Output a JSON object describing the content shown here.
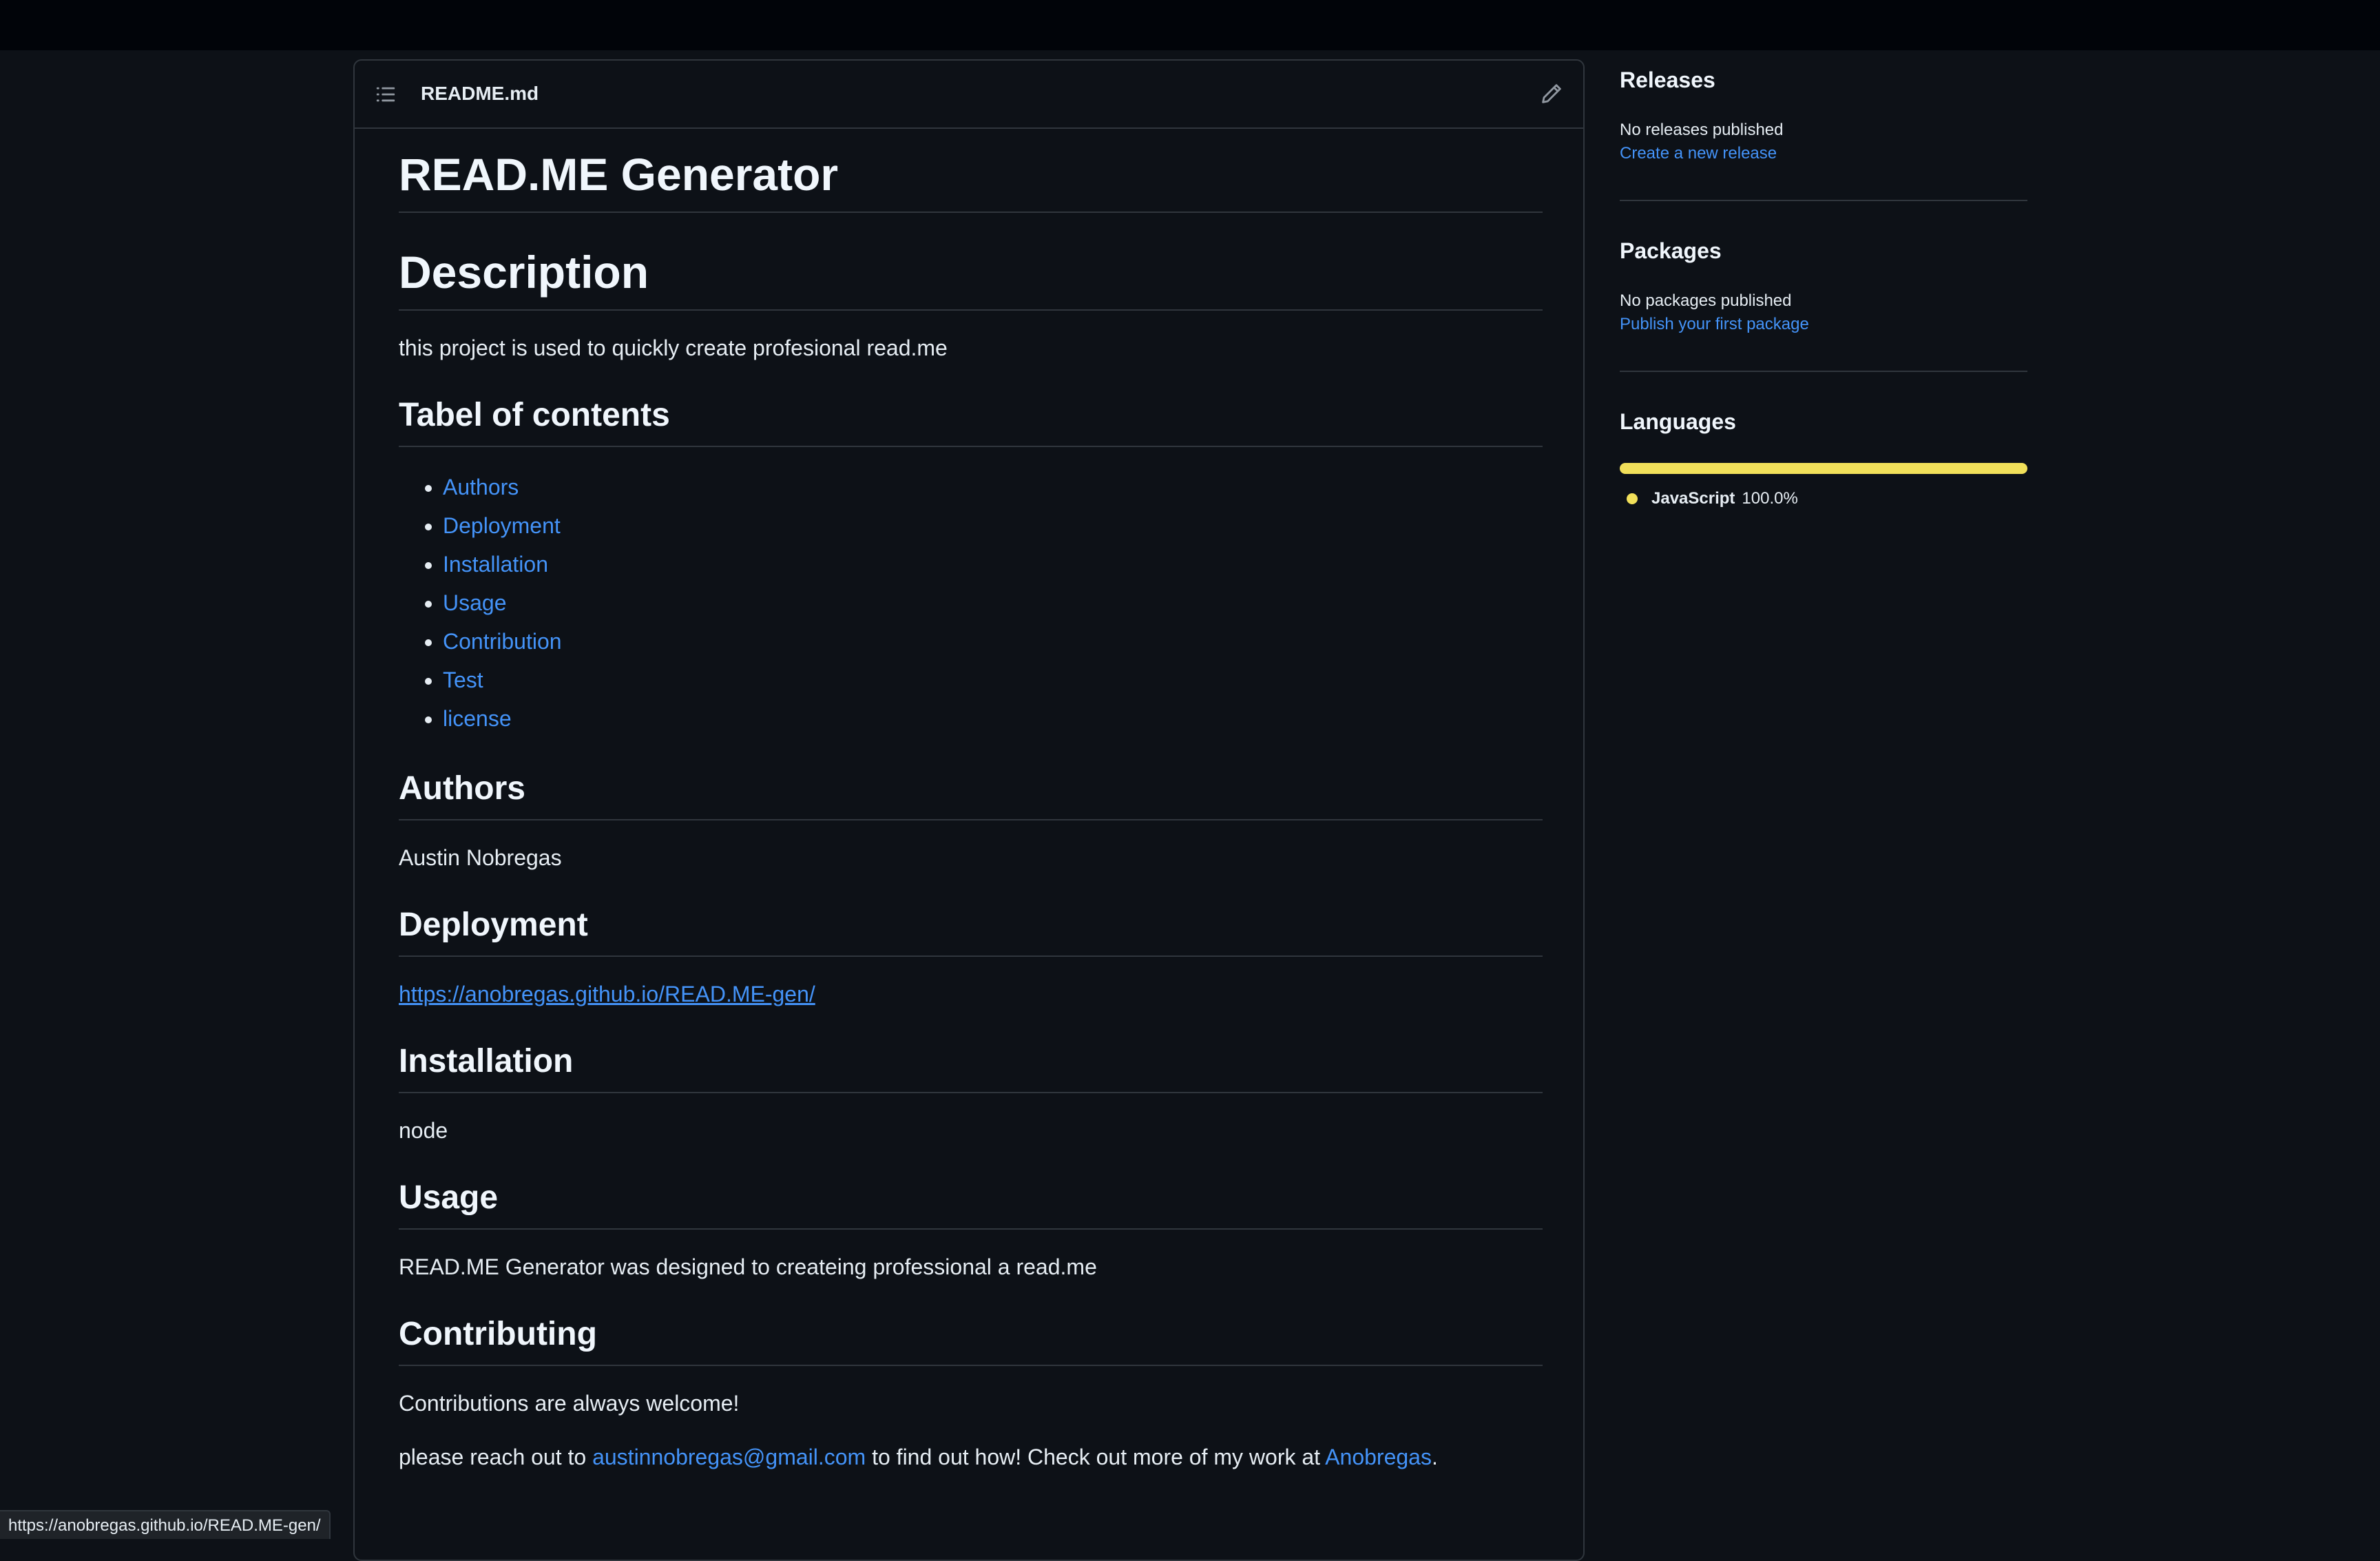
{
  "readme": {
    "filename": "README.md",
    "title": "READ.ME Generator",
    "description_heading": "Description",
    "description_text": "this project is used to quickly create profesional read.me",
    "toc_heading": "Tabel of contents",
    "toc_items": [
      "Authors",
      "Deployment",
      "Installation",
      "Usage",
      "Contribution",
      "Test",
      "license"
    ],
    "authors_heading": "Authors",
    "authors_text": "Austin Nobregas",
    "deployment_heading": "Deployment",
    "deployment_link": "https://anobregas.github.io/READ.ME-gen/",
    "installation_heading": "Installation",
    "installation_text": "node",
    "usage_heading": "Usage",
    "usage_text": "READ.ME Generator was designed to createing professional a read.me",
    "contributing_heading": "Contributing",
    "contributing_text": "Contributions are always welcome!",
    "contact_prefix": "please reach out to ",
    "contact_email": "austinnobregas@gmail.com",
    "contact_middle": " to find out how! Check out more of my work at ",
    "contact_profile": "Anobregas",
    "contact_suffix": "."
  },
  "sidebar": {
    "releases": {
      "title": "Releases",
      "text": "No releases published",
      "link": "Create a new release"
    },
    "packages": {
      "title": "Packages",
      "text": "No packages published",
      "link": "Publish your first package"
    },
    "languages": {
      "title": "Languages",
      "items": [
        {
          "name": "JavaScript",
          "percent": "100.0%",
          "color": "#f1e05a"
        }
      ]
    }
  },
  "status_bar": {
    "url": "https://anobregas.github.io/READ.ME-gen/"
  },
  "colors": {
    "background": "#0d1117",
    "link": "#4493f8",
    "border": "#30363d",
    "javascript": "#f1e05a"
  }
}
